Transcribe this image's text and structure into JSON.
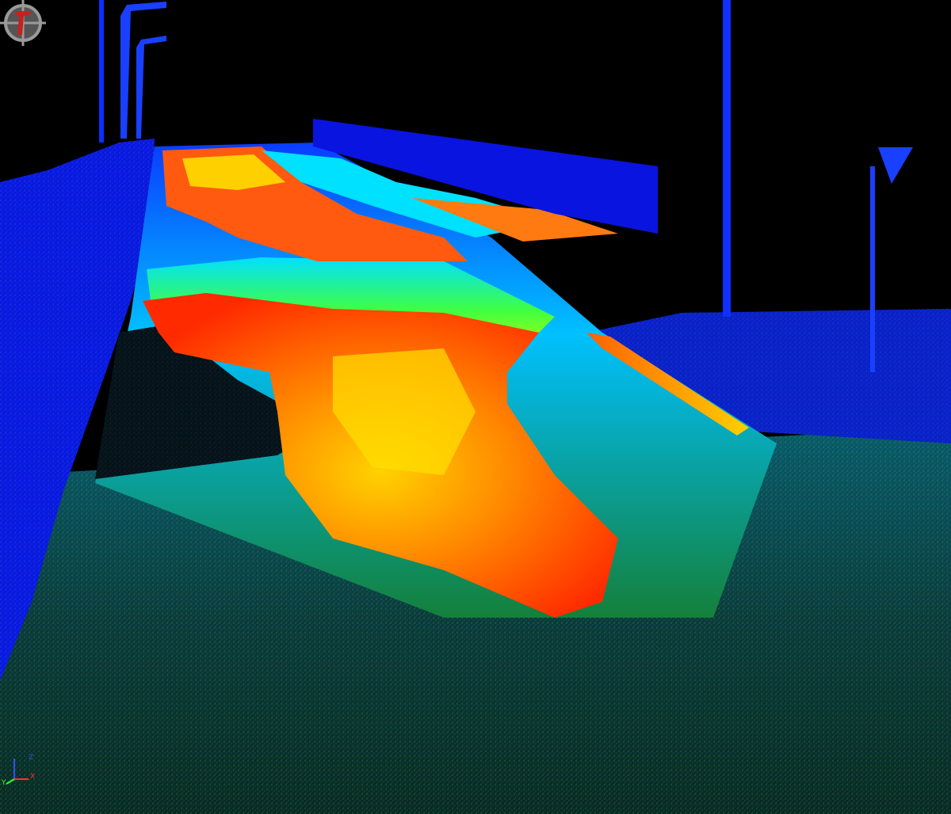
{
  "view": {
    "background_color": "#000000",
    "logo_icon": "target-crosshair-logo-icon",
    "colormap": [
      "#0000ff",
      "#00c8ff",
      "#00ff80",
      "#ffff00",
      "#ff8000",
      "#ff2000"
    ]
  },
  "axes": {
    "icon": "xyz-axis-triad-icon",
    "x": "X",
    "y": "Y",
    "z": "Z",
    "x_color": "#ff3030",
    "y_color": "#30ff30",
    "z_color": "#3050ff"
  }
}
